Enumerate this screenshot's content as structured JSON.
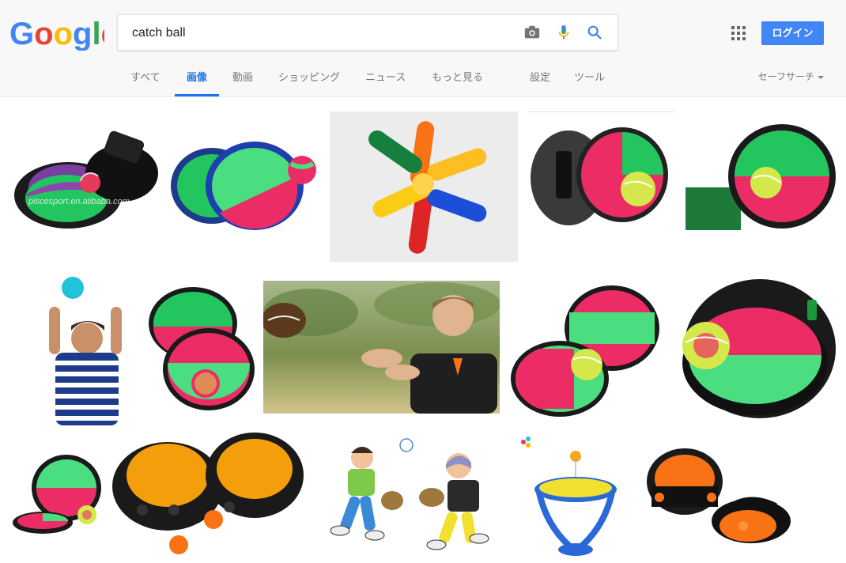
{
  "search": {
    "query": "catch ball"
  },
  "header": {
    "login_label": "ログイン"
  },
  "tabs": [
    {
      "label": "すべて"
    },
    {
      "label": "画像"
    },
    {
      "label": "動画"
    },
    {
      "label": "ショッピング"
    },
    {
      "label": "ニュース"
    },
    {
      "label": "もっと見る"
    },
    {
      "label": "設定"
    },
    {
      "label": "ツール"
    }
  ],
  "safesearch_label": "セーフサーチ",
  "active_tab": "画像",
  "colors": {
    "accent": "#1a73e8",
    "login_button": "#4285f4",
    "header_bg": "#f8f8f8"
  },
  "icons": [
    "camera-icon",
    "microphone-icon",
    "search-icon",
    "apps-grid-icon",
    "caret-down-icon"
  ],
  "results": [
    {
      "watermark": "piscesport.en.alibaba.com"
    },
    {
      "watermark": ""
    },
    {
      "watermark": ""
    },
    {
      "watermark": ""
    },
    {
      "watermark": ""
    },
    {
      "watermark": ""
    },
    {
      "watermark": ""
    },
    {
      "watermark": ""
    },
    {
      "watermark": ""
    },
    {
      "watermark": ""
    },
    {
      "watermark": ""
    },
    {
      "watermark": ""
    },
    {
      "watermark": ""
    },
    {
      "watermark": ""
    },
    {
      "watermark": ""
    }
  ]
}
